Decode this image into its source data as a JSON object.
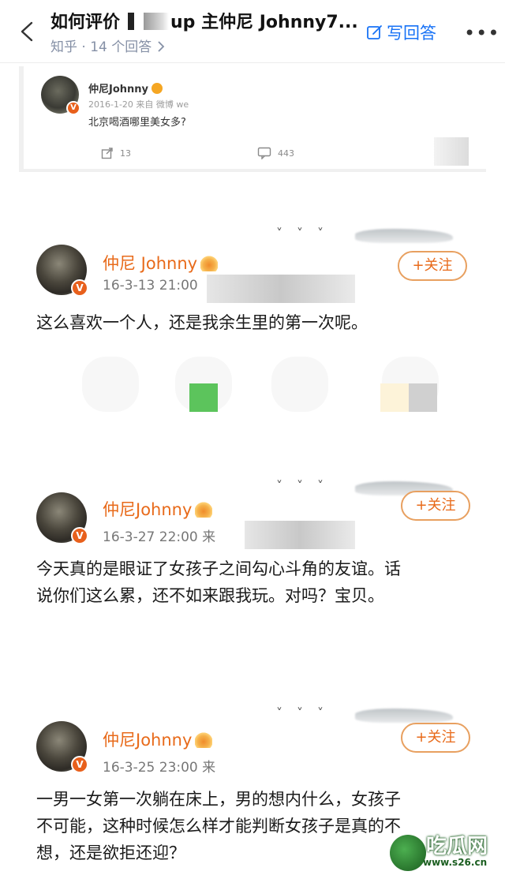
{
  "nav": {
    "title_left": "如何评价",
    "title_right": "up 主仲尼 Johnny7...",
    "subtitle": "知乎 · 14 个回答",
    "answer_label": "写回答"
  },
  "mini_post": {
    "author": "仲尼Johnny",
    "meta": "2016-1-20 来自 微博 we",
    "text": "北京喝酒哪里美女多?",
    "repost_count": "13",
    "comment_count": "443"
  },
  "posts": [
    {
      "author": "仲尼 Johnny",
      "time": "16-3-13 21:00",
      "follow": "+关注",
      "text": "这么喜欢一个人，还是我余生里的第一次呢。"
    },
    {
      "author": "仲尼Johnny",
      "time": "16-3-27 22:00 来",
      "follow": "+关注",
      "text_line1": "今天真的是眼证了女孩子之间勾心斗角的友谊。话",
      "text_line2": "说你们这么累，还不如来跟我玩。对吗？宝贝。"
    },
    {
      "author": "仲尼Johnny",
      "time": "16-3-25 23:00 来",
      "follow": "+关注",
      "text_line1": "一男一女第一次躺在床上，男的想内什么，女孩子",
      "text_line2": "不可能，这种时候怎么样才能判断女孩子是真的不",
      "text_line3": "想，还是欲拒还迎？"
    }
  ],
  "watermark": {
    "name": "吃瓜网",
    "url": "www.s26.cn"
  },
  "colors": {
    "accent_blue": "#1772f6",
    "weibo_orange": "#e86a1a"
  }
}
